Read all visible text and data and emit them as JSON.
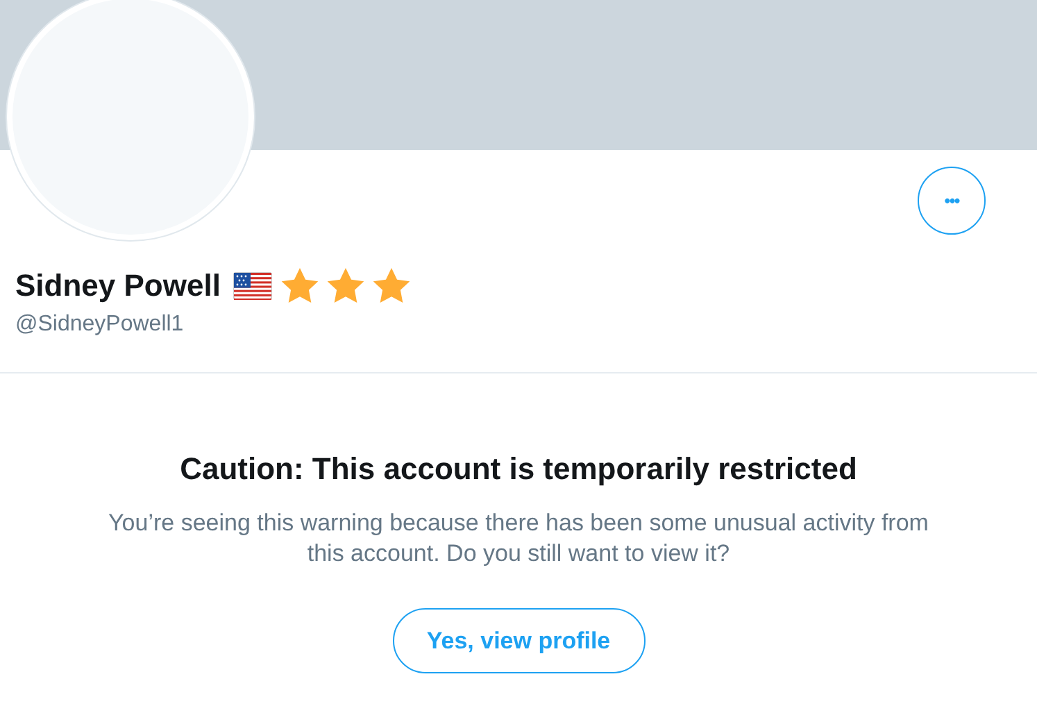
{
  "profile": {
    "name": "Sidney Powell",
    "badges": [
      {
        "kind": "flag"
      },
      {
        "kind": "star"
      },
      {
        "kind": "star"
      },
      {
        "kind": "star"
      }
    ],
    "handle": "@SidneyPowell1",
    "more_button": "•••"
  },
  "warning": {
    "title": "Caution: This account is temporarily restricted",
    "message": "You’re seeing this warning because there has been some unusual activity from this account. Do you still want to view it?",
    "button": "Yes, view profile"
  }
}
